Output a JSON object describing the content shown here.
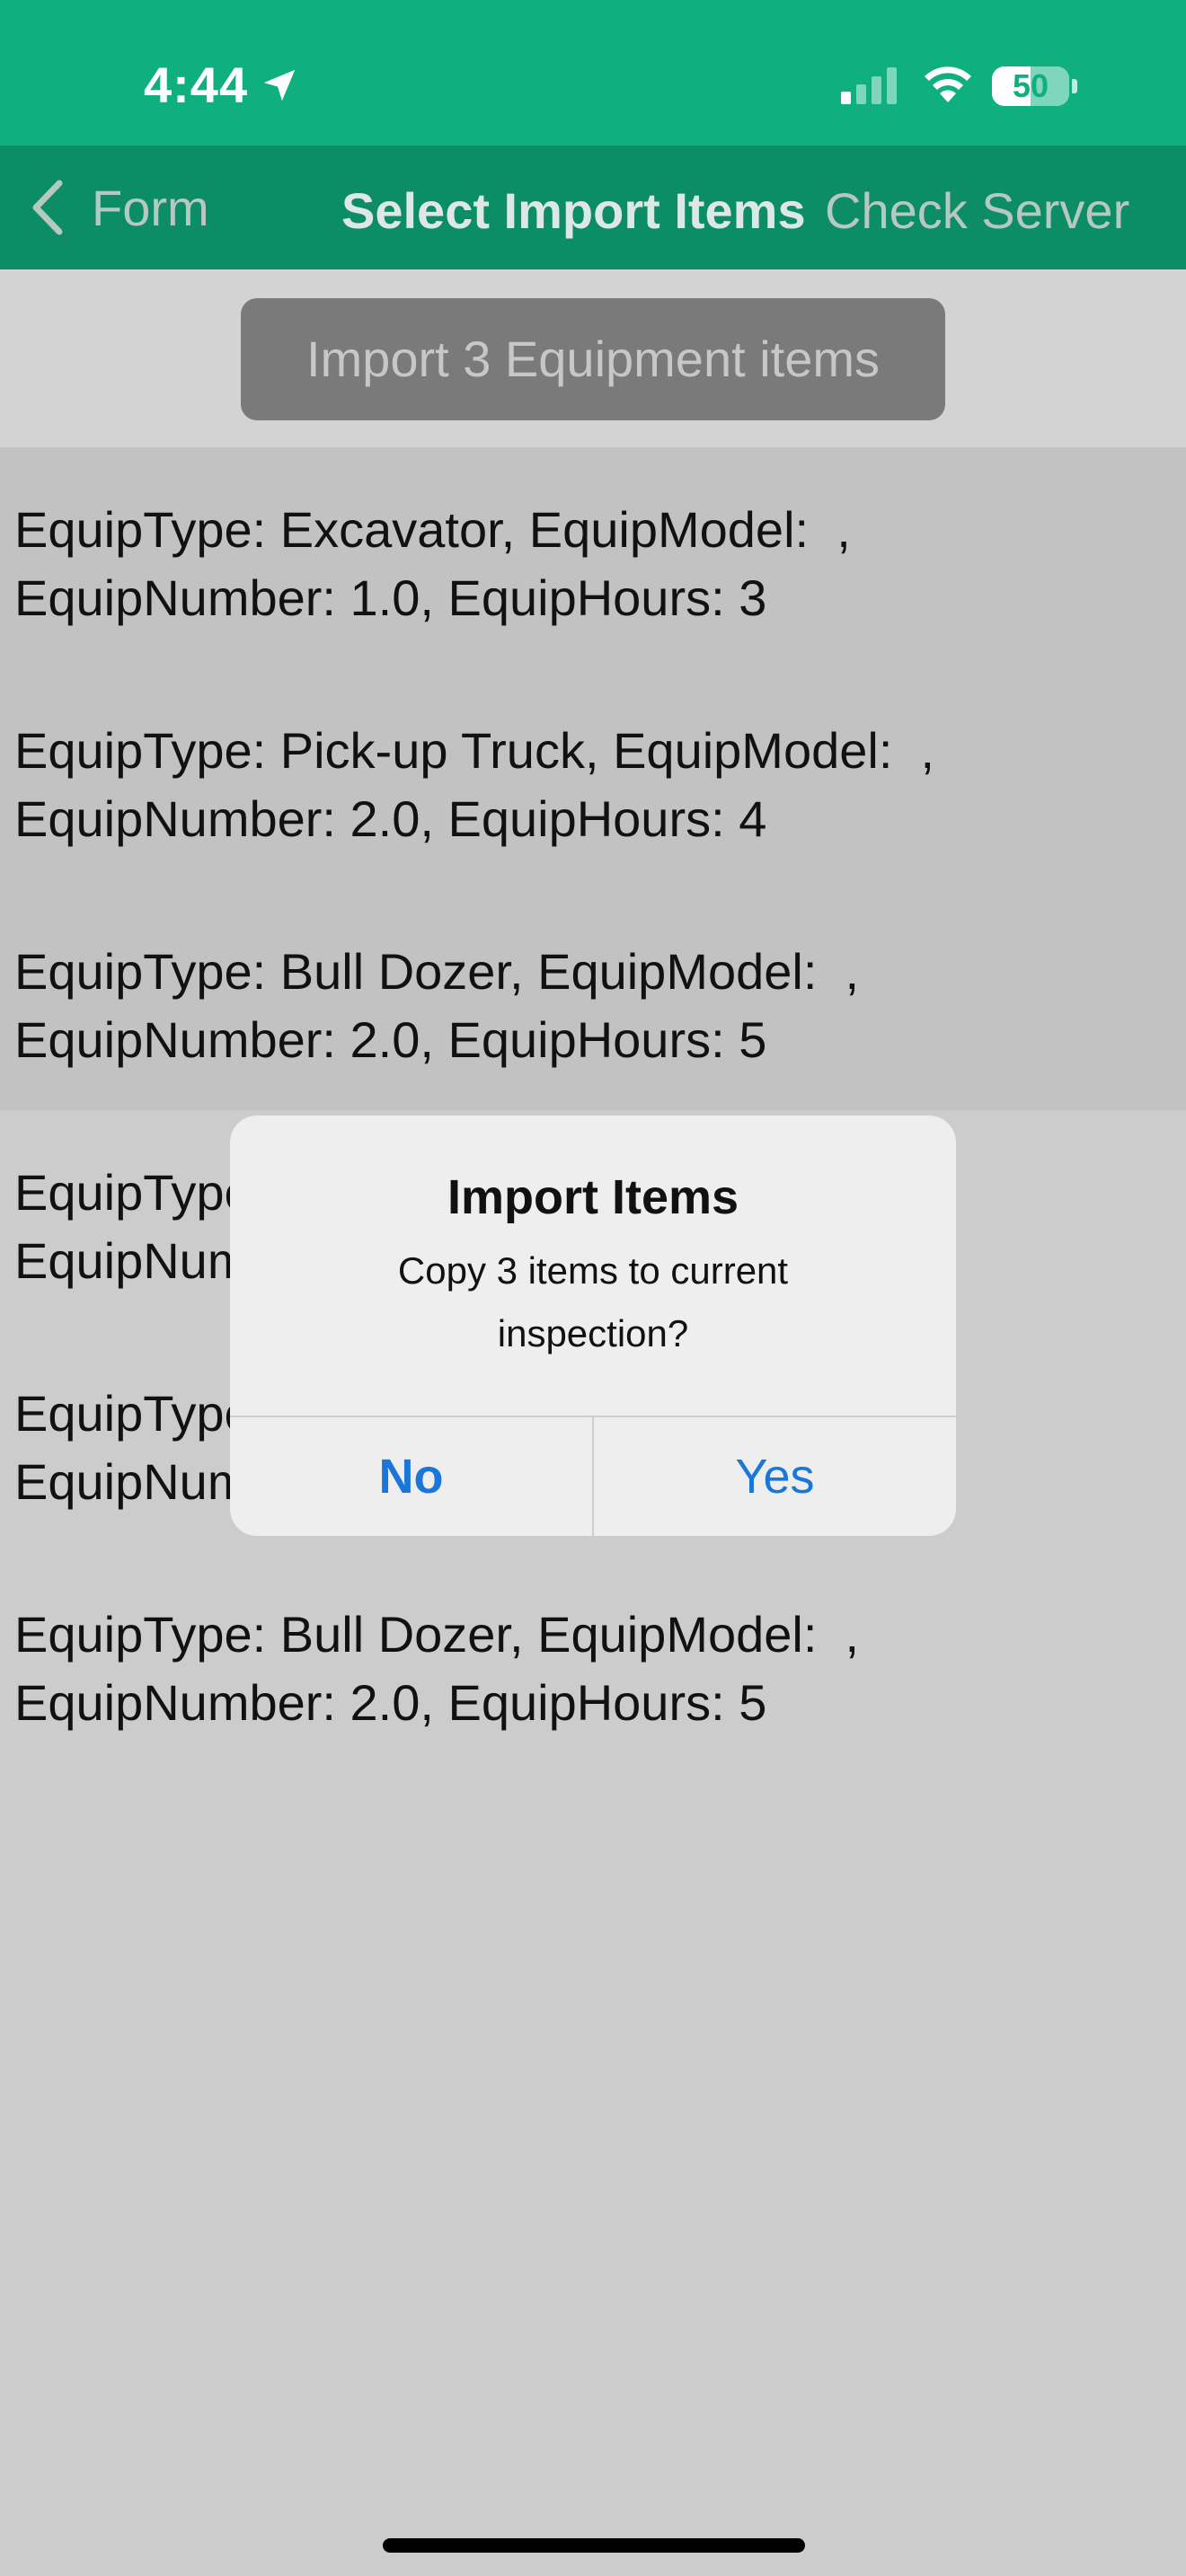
{
  "status_bar": {
    "time": "4:44",
    "battery": "50",
    "battery_level": 0.5,
    "signal_bars_active": 1,
    "signal_bars_total": 4,
    "icons": [
      "location-arrow-icon",
      "cellular-signal-icon",
      "wifi-icon",
      "battery-icon"
    ]
  },
  "nav": {
    "back_label": "Form",
    "title": "Select Import Items",
    "right_label": "Check Server"
  },
  "toolbar": {
    "import_button": "Import 3 Equipment items"
  },
  "items": [
    {
      "line1": "EquipType: Excavator, EquipModel:  ,",
      "line2": "EquipNumber: 1.0, EquipHours: 3",
      "selected": true
    },
    {
      "line1": "EquipType: Pick-up Truck, EquipModel:  ,",
      "line2": "EquipNumber: 2.0, EquipHours: 4",
      "selected": true
    },
    {
      "line1": "EquipType: Bull Dozer, EquipModel:  ,",
      "line2": "EquipNumber: 2.0, EquipHours: 5",
      "selected": true
    },
    {
      "line1": "EquipType: Excavator, EquipModel:  ,",
      "line2": "EquipNumber: 1.0, EquipHours: 3",
      "selected": false
    },
    {
      "line1": "EquipType: Pick-up Truck, EquipModel:  ,",
      "line2": "EquipNumber: 2.0, EquipHours: 4",
      "selected": false
    },
    {
      "line1": "EquipType: Bull Dozer, EquipModel:  ,",
      "line2": "EquipNumber: 2.0, EquipHours: 5",
      "selected": false
    }
  ],
  "dialog": {
    "title": "Import Items",
    "message": "Copy 3 items to current inspection?",
    "no_label": "No",
    "yes_label": "Yes"
  },
  "colors": {
    "status_bar": "#0faf7f",
    "nav_bar": "#0d8d66",
    "dialog_button": "#1a76d9"
  }
}
